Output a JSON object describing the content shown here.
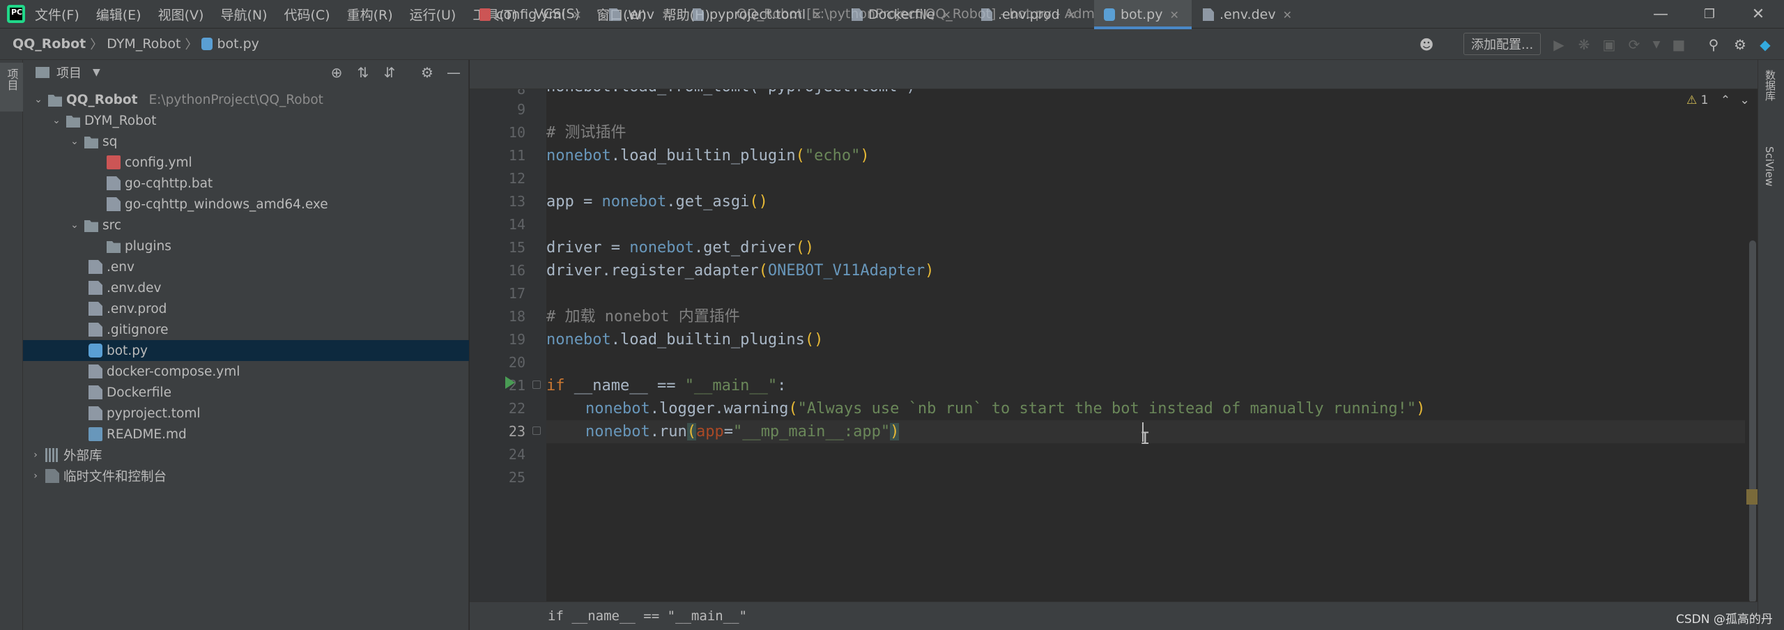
{
  "menu": [
    "文件(F)",
    "编辑(E)",
    "视图(V)",
    "导航(N)",
    "代码(C)",
    "重构(R)",
    "运行(U)",
    "工具(T)",
    "VCS(S)",
    "窗口(W)",
    "帮助(H)"
  ],
  "window_title": "QQ_Robot [E:\\pythonProject\\QQ_Robot] - bot.py - Administrator",
  "breadcrumb": [
    "QQ_Robot",
    "DYM_Robot",
    "bot.py"
  ],
  "toolbar": {
    "add_config": "添加配置..."
  },
  "left_strip": {
    "project_tab": "项目"
  },
  "project_panel": {
    "title": "项目",
    "tree": [
      {
        "label": "QQ_Robot",
        "path": "E:\\pythonProject\\QQ_Robot"
      },
      {
        "label": "DYM_Robot"
      },
      {
        "label": "sq"
      },
      {
        "label": "config.yml"
      },
      {
        "label": "go-cqhttp.bat"
      },
      {
        "label": "go-cqhttp_windows_amd64.exe"
      },
      {
        "label": "src"
      },
      {
        "label": "plugins"
      },
      {
        "label": ".env"
      },
      {
        "label": ".env.dev"
      },
      {
        "label": ".env.prod"
      },
      {
        "label": ".gitignore"
      },
      {
        "label": "bot.py"
      },
      {
        "label": "docker-compose.yml"
      },
      {
        "label": "Dockerfile"
      },
      {
        "label": "pyproject.toml"
      },
      {
        "label": "README.md"
      },
      {
        "label": "外部库"
      },
      {
        "label": "临时文件和控制台"
      }
    ]
  },
  "tabs": [
    "config.yml",
    ".env",
    "pyproject.toml",
    "Dockerfile",
    ".env.prod",
    "bot.py",
    ".env.dev"
  ],
  "active_tab": "bot.py",
  "editor": {
    "warning_count": "1",
    "line_numbers": [
      "8",
      "9",
      "10",
      "11",
      "12",
      "13",
      "14",
      "15",
      "16",
      "17",
      "18",
      "19",
      "20",
      "21",
      "22",
      "23",
      "24",
      "25"
    ],
    "top_partial_line": "nonebot.load_from_toml(\"pyproject.toml\")",
    "lines": {
      "l10": "# 测试插件",
      "l11_obj": "nonebot",
      "l11_fn": ".load_builtin_plugin",
      "l11_arg": "\"echo\"",
      "l13_a": "app = ",
      "l13_obj": "nonebot",
      "l13_fn": ".get_asgi",
      "l15_a": "driver = ",
      "l15_obj": "nonebot",
      "l15_fn": ".get_driver",
      "l16_a": "driver.register_adapter",
      "l16_arg": "ONEBOT_V11Adapter",
      "l18": "# 加载 nonebot 内置插件",
      "l19_obj": "nonebot",
      "l19_fn": ".load_builtin_plugins",
      "l21_kw": "if",
      "l21_a": " __name__ == ",
      "l21_str": "\"__main__\"",
      "l21_b": ":",
      "l22_obj": "nonebot",
      "l22_fn": ".logger.warning",
      "l22_str": "\"Always use `nb run` to start the bot instead of manually running!\"",
      "l23_obj": "nonebot",
      "l23_fn": ".run",
      "l23_param": "app",
      "l23_eq": "=",
      "l23_str": "\"__mp_main__:app\""
    }
  },
  "footer_breadcrumb": "if __name__ == \"__main__\"",
  "right_strip": [
    "数据库",
    "SciView"
  ],
  "watermark": "CSDN @孤高的丹"
}
